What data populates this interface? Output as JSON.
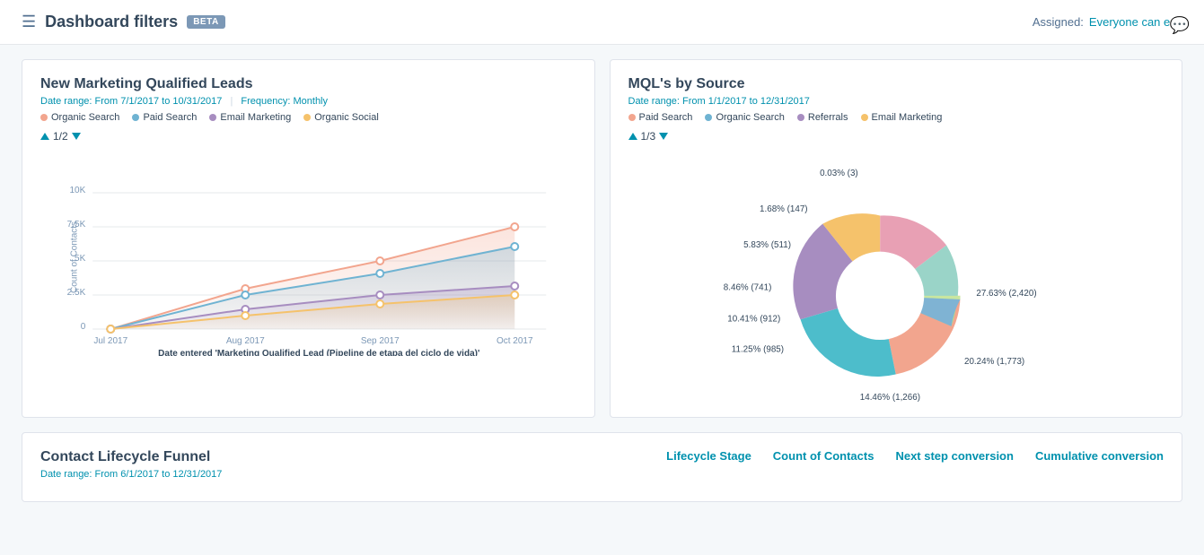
{
  "header": {
    "title": "Dashboard filters",
    "beta_label": "BETA",
    "assigned_label": "Assigned:",
    "assigned_value": "Everyone can edit"
  },
  "card1": {
    "title": "New Marketing Qualified Leads",
    "date_range": "Date range: From 7/1/2017 to 10/31/2017",
    "frequency": "Frequency: Monthly",
    "pagination": "1/2",
    "legend": [
      {
        "label": "Organic Search",
        "color": "#f2a58e"
      },
      {
        "label": "Paid Search",
        "color": "#6fb3d2"
      },
      {
        "label": "Email Marketing",
        "color": "#a78dc0"
      },
      {
        "label": "Organic Social",
        "color": "#f5c26b"
      }
    ],
    "x_axis": [
      "Jul 2017",
      "Aug 2017",
      "Sep 2017",
      "Oct 2017"
    ],
    "x_label": "Date entered 'Marketing Qualified Lead (Pipeline de etapa del ciclo de vida)'",
    "y_label": "Count of Contacts",
    "y_axis": [
      "0",
      "2.5K",
      "5K",
      "7.5K",
      "10K"
    ]
  },
  "card2": {
    "title": "MQL's by Source",
    "date_range": "Date range: From 1/1/2017 to 12/31/2017",
    "pagination": "1/3",
    "legend": [
      {
        "label": "Paid Search",
        "color": "#f2a58e"
      },
      {
        "label": "Organic Search",
        "color": "#6fb3d2"
      },
      {
        "label": "Referrals",
        "color": "#a78dc0"
      },
      {
        "label": "Email Marketing",
        "color": "#f5c26b"
      }
    ],
    "segments": [
      {
        "label": "27.63% (2,420)",
        "color": "#f2a58e",
        "pct": 27.63
      },
      {
        "label": "20.24% (1,773)",
        "color": "#4dbdcb",
        "pct": 20.24
      },
      {
        "label": "14.46% (1,266)",
        "color": "#a78dc0",
        "pct": 14.46
      },
      {
        "label": "11.25% (985)",
        "color": "#f5c26b",
        "pct": 11.25
      },
      {
        "label": "10.41% (912)",
        "color": "#e8a0b4",
        "pct": 10.41
      },
      {
        "label": "8.46% (741)",
        "color": "#9ad4c8",
        "pct": 8.46
      },
      {
        "label": "5.83% (511)",
        "color": "#b8d98d",
        "pct": 5.83
      },
      {
        "label": "1.68% (147)",
        "color": "#7fb3d3",
        "pct": 1.68
      },
      {
        "label": "0.03% (3)",
        "color": "#c8e6a0",
        "pct": 0.03
      }
    ]
  },
  "card3": {
    "title": "Contact Lifecycle Funnel",
    "date_range": "Date range: From 6/1/2017 to 12/31/2017",
    "col1": "Lifecycle Stage",
    "col2": "Count of Contacts",
    "col3": "Next step conversion",
    "col4": "Cumulative conversion"
  }
}
